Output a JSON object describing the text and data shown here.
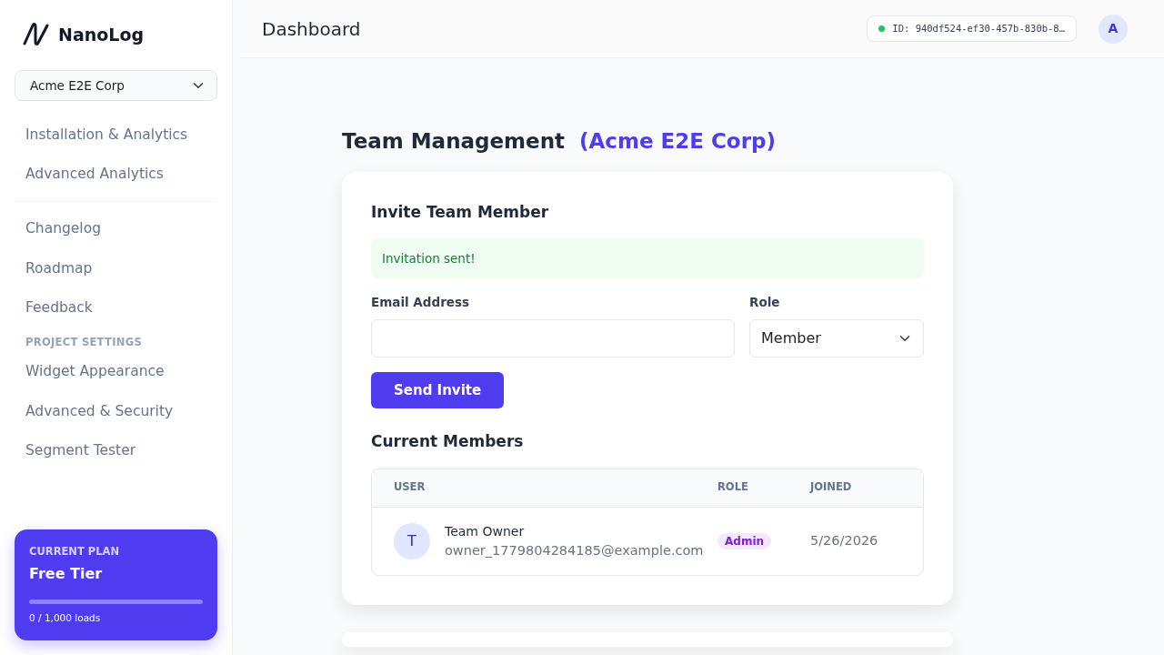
{
  "brand": {
    "name": "NanoLog"
  },
  "project_select": {
    "value": "Acme E2E Corp"
  },
  "sidebar": {
    "groups": [
      {
        "items": [
          {
            "label": "Installation & Analytics"
          },
          {
            "label": "Advanced Analytics"
          }
        ]
      },
      {
        "items": [
          {
            "label": "Changelog"
          },
          {
            "label": "Roadmap"
          },
          {
            "label": "Feedback"
          }
        ]
      },
      {
        "heading": "PROJECT SETTINGS",
        "items": [
          {
            "label": "Widget Appearance"
          },
          {
            "label": "Advanced & Security"
          },
          {
            "label": "Segment Tester"
          }
        ]
      }
    ]
  },
  "plan": {
    "heading": "CURRENT PLAN",
    "name": "Free Tier",
    "usage": "0 / 1,000 loads"
  },
  "header": {
    "title": "Dashboard",
    "project_id": "ID: 940df524-ef30-457b-830b-8…",
    "avatar": "A"
  },
  "page": {
    "title": "Team Management",
    "org": "(Acme E2E Corp)"
  },
  "invite": {
    "title": "Invite Team Member",
    "alert": "Invitation sent!",
    "email_label": "Email Address",
    "role_label": "Role",
    "role_value": "Member",
    "button": "Send Invite"
  },
  "members": {
    "title": "Current Members",
    "columns": [
      "USER",
      "ROLE",
      "JOINED"
    ],
    "rows": [
      {
        "initial": "T",
        "name": "Team Owner",
        "email": "owner_1779804284185@example.com",
        "role": "Admin",
        "joined": "5/26/2026"
      }
    ]
  }
}
